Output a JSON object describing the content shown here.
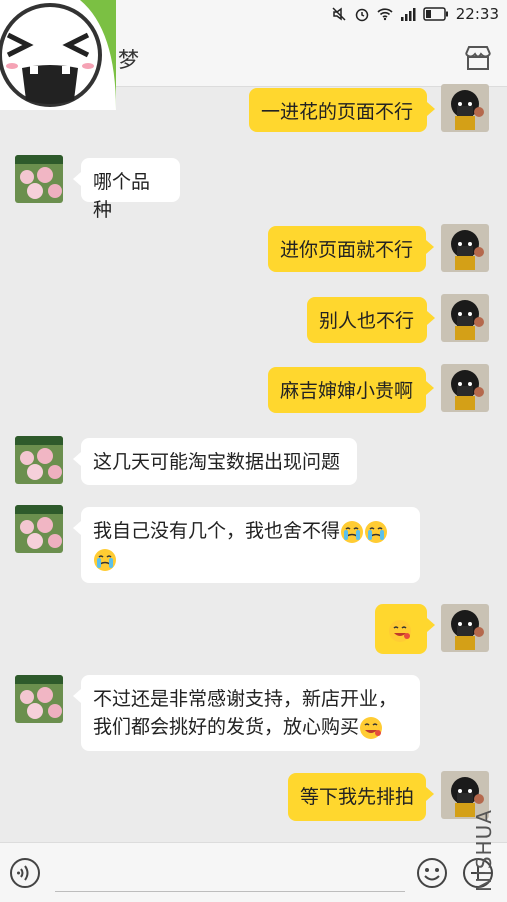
{
  "status_bar": {
    "time": "22:33"
  },
  "header": {
    "title": "梦"
  },
  "messages": [
    {
      "sender": "me",
      "text": "一进花的页面不行"
    },
    {
      "sender": "them",
      "text": "哪个品种"
    },
    {
      "sender": "me",
      "text": "进你页面就不行"
    },
    {
      "sender": "me",
      "text": "别人也不行"
    },
    {
      "sender": "me",
      "text": "麻吉婶婶小贵啊"
    },
    {
      "sender": "them",
      "text": "这几天可能淘宝数据出现问题"
    },
    {
      "sender": "them",
      "text": "我自己没有几个，我也舍不得"
    },
    {
      "sender": "me",
      "text": ""
    },
    {
      "sender": "them",
      "text_line1": "不过还是非常感谢支持，新店开业，",
      "text_line2": "我们都会挑好的发货，放心购买"
    },
    {
      "sender": "me",
      "text": "等下我先排拍"
    }
  ],
  "watermark": "NISHUA",
  "colors": {
    "my_bubble": "#ffd72e",
    "their_bubble": "#ffffff",
    "background": "#ebebeb"
  }
}
